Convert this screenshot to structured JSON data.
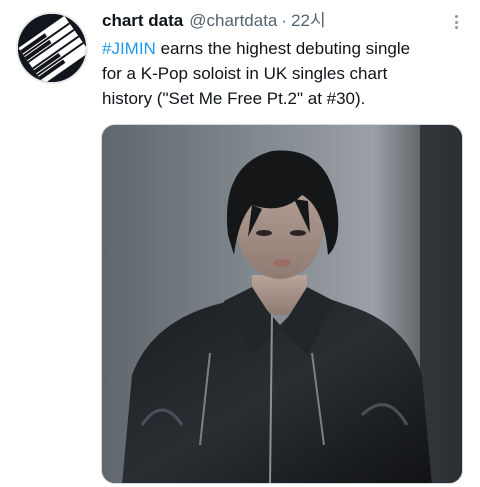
{
  "tweet": {
    "display_name": "chart data",
    "handle": "@chartdata",
    "separator": "·",
    "time": "22시",
    "text_hashtag": "#JIMIN",
    "text_line1_rest": " earns the highest debuting single",
    "text_line2": "for a K-Pop soloist in UK singles chart",
    "text_line3": "history (\"Set Me Free Pt.2\" at #30).",
    "more_icon": "more-options-icon",
    "avatar_icon": "piano-keys-logo",
    "media_alt": "photo"
  },
  "colors": {
    "accent": "#1d9bf0",
    "text": "#0f1419",
    "secondary": "#536471"
  }
}
